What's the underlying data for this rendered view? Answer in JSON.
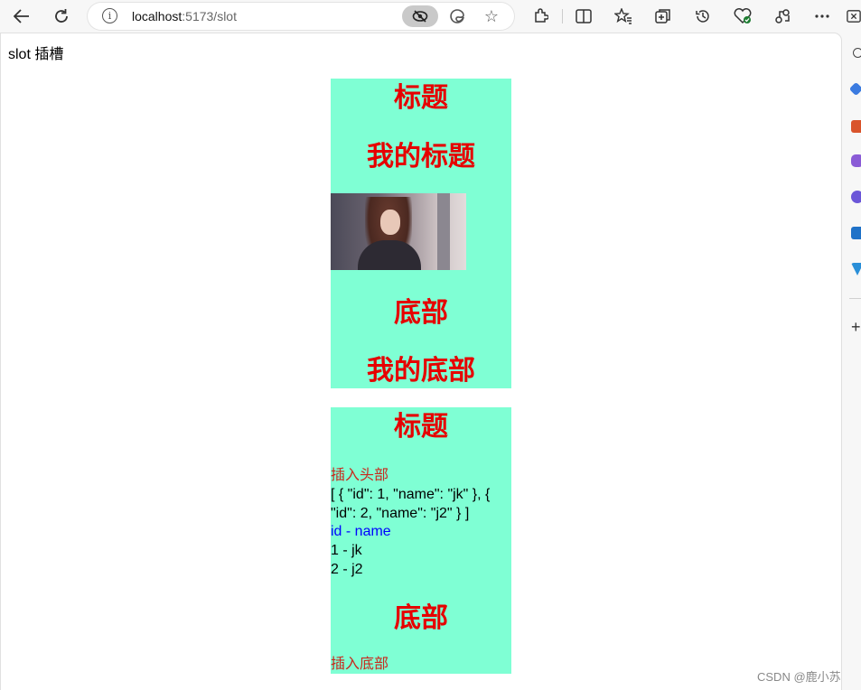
{
  "browser": {
    "url_host": "localhost",
    "url_path": ":5173/slot",
    "icons": [
      "back-arrow-icon",
      "reload-icon",
      "info-icon",
      "tracking-prevention-icon",
      "edge-icon",
      "favorite-star-icon",
      "extensions-icon",
      "split-screen-icon",
      "favorites-icon",
      "collections-icon",
      "history-icon",
      "browser-essentials-icon",
      "share-icon",
      "more-icon",
      "close-icon"
    ]
  },
  "page": {
    "heading": "slot 插槽",
    "card1": {
      "title": "标题",
      "subtitle": "我的标题",
      "footer": "底部",
      "footer_sub": "我的底部"
    },
    "card2": {
      "title": "标题",
      "header_slot": "插入头部",
      "json_text": "[ { \"id\": 1, \"name\": \"jk\" }, { \"id\": 2, \"name\": \"j2\" } ]",
      "list_header": "id - name",
      "rows": [
        "1 - jk",
        "2 - j2"
      ],
      "footer": "底部",
      "footer_slot": "插入底部"
    },
    "colors": {
      "card_bg": "#7fffd4",
      "heading_red": "#e60000",
      "slot_text": "#c8291e",
      "list_header": "#0000ff"
    }
  },
  "watermark": "CSDN @鹿小苏"
}
